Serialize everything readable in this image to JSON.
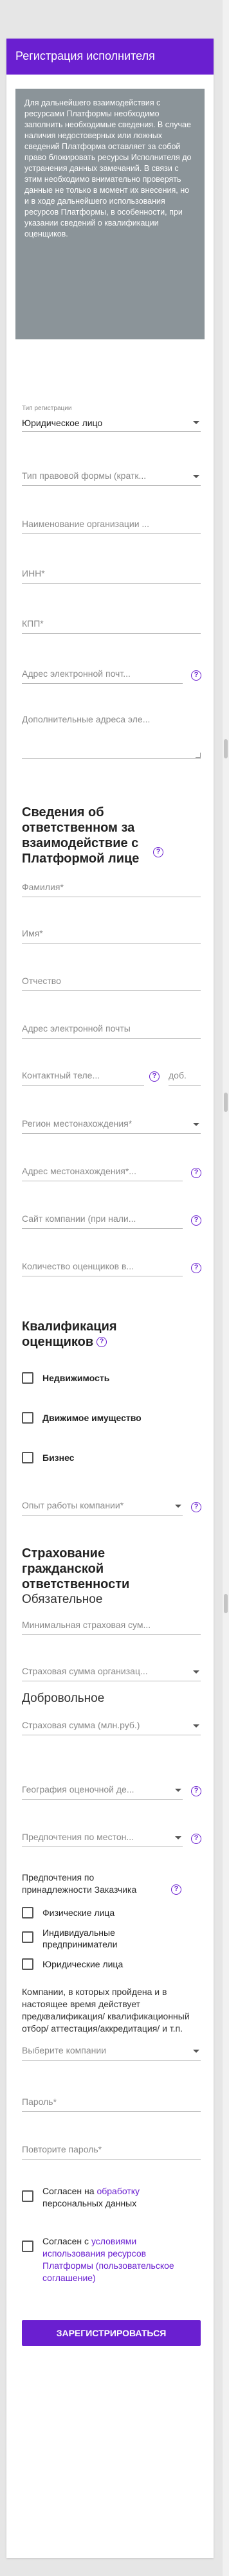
{
  "header": {
    "title": "Регистрация исполнителя"
  },
  "info_text": "Для дальнейшего взаимодействия с ресурсами Платформы необходимо заполнить необходимые сведения. В случае наличия недостоверных или ложных сведений Платформа оставляет за собой право блокировать ресурсы Исполнителя до устранения данных замечаний. В связи с этим необходимо внимательно проверять данные не только в момент их внесения, но и в ходе дальнейшего использования ресурсов Платформы, в особенности, при указании сведений о квалификации оценщиков.",
  "registration_type": {
    "label": "Тип регистрации",
    "value": "Юридическое лицо"
  },
  "legal_form": {
    "placeholder": "Тип правовой формы (кратк..."
  },
  "org_name": {
    "placeholder": "Наименование организации ..."
  },
  "inn": {
    "placeholder": "ИНН*"
  },
  "kpp": {
    "placeholder": "КПП*"
  },
  "email": {
    "placeholder": "Адрес электронной почт..."
  },
  "extra_emails": {
    "placeholder": "Дополнительные адреса эле..."
  },
  "responsible": {
    "title": "Сведения об ответственном за взаимодействие с Платформой лице",
    "last_name": "Фамилия*",
    "first_name": "Имя*",
    "middle_name": "Отчество",
    "email": "Адрес электронной почты",
    "phone": "Контактный теле...",
    "ext": "доб.",
    "region": "Регион местонахождения*",
    "address": "Адрес местонахождения*...",
    "website": "Сайт компании (при нали...",
    "appraisers_count": "Количество оценщиков в..."
  },
  "qualification": {
    "title": "Квалификация оценщиков",
    "items": [
      "Недвижимость",
      "Движимое имущество",
      "Бизнес"
    ],
    "experience": "Опыт работы компании*"
  },
  "insurance": {
    "title": "Страхование гражданской ответственности",
    "mandatory": "Обязательное",
    "min_sum": "Минимальная страховая сум...",
    "org_sum": "Страховая сумма организац...",
    "voluntary": "Добровольное",
    "vol_sum": "Страховая сумма (млн.руб.)"
  },
  "geography": "География оценочной де...",
  "location_pref": "Предпочтения по местон...",
  "customer_pref": {
    "title": "Предпочтения по принадлежности Заказчика",
    "items": [
      "Физические лица",
      "Индивидуальные предприниматели",
      "Юридические лица"
    ]
  },
  "companies_text": "Компании, в которых пройдена и в настоящее время действует предквалификация/ квалификационный отбор/ аттестация/аккредитация/ и т.п.",
  "select_company": "Выберите компании",
  "password": "Пароль*",
  "password_repeat": "Повторите пароль*",
  "consent1": {
    "prefix": "Согласен на ",
    "link": "обработку",
    "suffix": " персональных данных"
  },
  "consent2": {
    "prefix": "Согласен с ",
    "link": "условиями использования ресурсов Платформы",
    "suffix": " (пользовательское соглашение)"
  },
  "submit": "ЗАРЕГИСТРИРОВАТЬСЯ",
  "colors": {
    "accent": "#6a1fd0",
    "info_bg": "#8b9499",
    "page_bg": "#e6e6e6"
  }
}
